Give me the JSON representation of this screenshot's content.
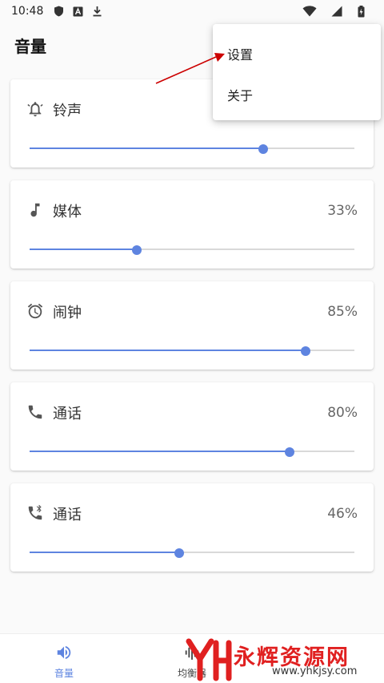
{
  "status_bar": {
    "time": "10:48"
  },
  "app": {
    "title": "音量"
  },
  "menu": {
    "items": [
      {
        "label": "设置"
      },
      {
        "label": "关于"
      }
    ]
  },
  "cards": [
    {
      "label": "铃声",
      "percent": "",
      "level": 0.72,
      "icon": "bell-icon"
    },
    {
      "label": "媒体",
      "percent": "33%",
      "level": 0.33,
      "icon": "music-note-icon"
    },
    {
      "label": "闹钟",
      "percent": "85%",
      "level": 0.85,
      "icon": "alarm-icon"
    },
    {
      "label": "通话",
      "percent": "80%",
      "level": 0.8,
      "icon": "phone-icon"
    },
    {
      "label": "通话",
      "percent": "46%",
      "level": 0.46,
      "icon": "bluetooth-phone-icon"
    }
  ],
  "bottom_nav": {
    "items": [
      {
        "label": "音量",
        "icon": "volume-icon",
        "active": true
      },
      {
        "label": "均衡器",
        "icon": "equalizer-icon",
        "active": false
      }
    ]
  },
  "watermark": {
    "text": "永辉资源网",
    "url": "www.yhkjsy.com"
  },
  "colors": {
    "accent": "#5e84e0",
    "icon": "#555555",
    "watermark": "#e02020",
    "annotation": "#cc0000"
  }
}
